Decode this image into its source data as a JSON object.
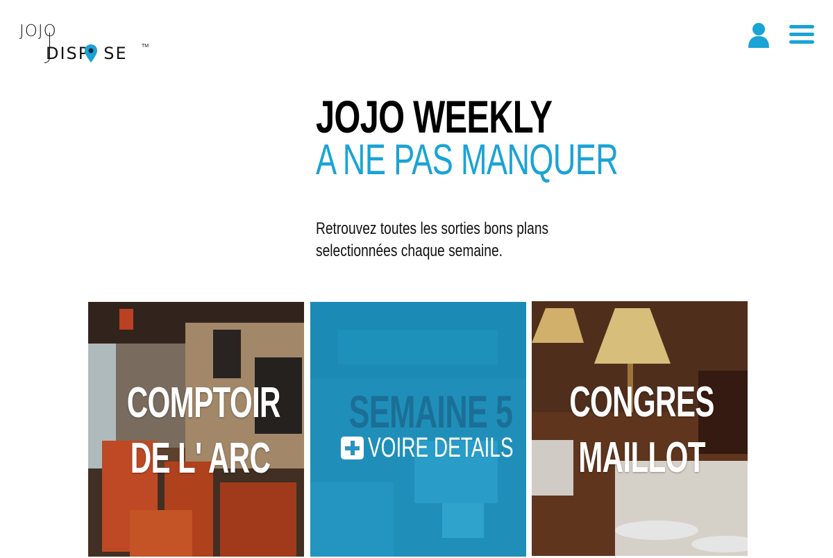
{
  "header": {
    "logo": {
      "top_text": "JOJO",
      "bottom_text": "DISPOSE",
      "trademark": "TM",
      "brand_color": "#1aa3d6"
    },
    "user_icon": "user-icon",
    "menu_icon": "hamburger-menu-icon"
  },
  "hero": {
    "title": "JOJO WEEKLY",
    "subtitle": "A NE PAS MANQUER",
    "intro_line1": "Retrouvez toutes les sorties bons plans",
    "intro_line2": "selectionnées chaque semaine."
  },
  "cards": [
    {
      "title_line1": "COMPTOIR",
      "title_line2": "DE L' ARC",
      "scene": "restaurant interior with orange chairs"
    },
    {
      "title": "SEMAINE 5",
      "details_label": "VOIRE DETAILS",
      "details_icon": "plus-square-icon",
      "overlay_color": "#1aa3d6"
    },
    {
      "title_line1": "CONGRES",
      "title_line2": "MAILLOT",
      "scene": "dining room with lamps and table settings"
    }
  ],
  "colors": {
    "accent": "#1aa3d6",
    "text": "#111111",
    "background": "#ffffff"
  }
}
